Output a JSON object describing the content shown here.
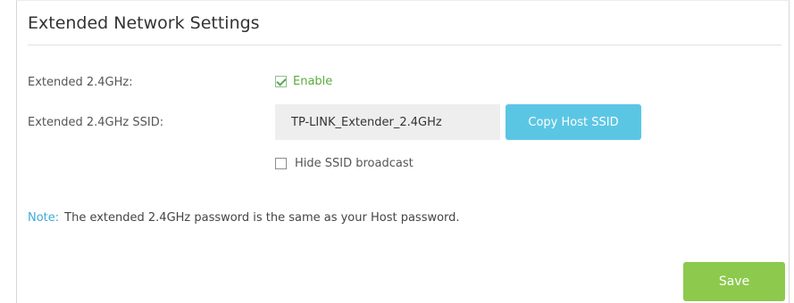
{
  "panel": {
    "title": "Extended Network Settings"
  },
  "extended_24ghz": {
    "label": "Extended 2.4GHz:",
    "enable_label": "Enable",
    "enabled": true
  },
  "ssid": {
    "label": "Extended 2.4GHz SSID:",
    "value": "TP-LINK_Extender_2.4GHz",
    "copy_button_label": "Copy Host SSID"
  },
  "hide_broadcast": {
    "label": "Hide SSID broadcast",
    "checked": false
  },
  "note": {
    "label": "Note:",
    "text": "The extended 2.4GHz password is the same as your Host password."
  },
  "actions": {
    "save_label": "Save"
  },
  "colors": {
    "accent_blue": "#5bc6e4",
    "save_green": "#8dc94d",
    "enable_green": "#5aab3d",
    "note_blue": "#3fa9d6"
  }
}
